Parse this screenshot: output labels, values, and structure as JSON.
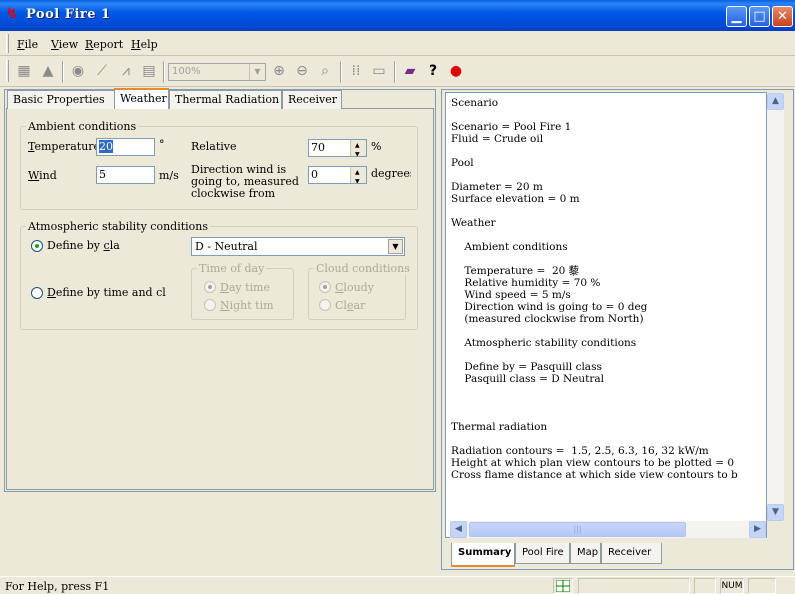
{
  "window": {
    "title": "Pool Fire 1",
    "icon": "app-logo-icon"
  },
  "menu": [
    {
      "key": "F",
      "rest": "ile"
    },
    {
      "key": "V",
      "rest": "iew"
    },
    {
      "key": "R",
      "rest": "eport"
    },
    {
      "key": "H",
      "rest": "elp"
    }
  ],
  "toolbar": {
    "zoom_value": "100%",
    "icons": [
      "table-icon",
      "mountain-icon",
      "person-icon",
      "graph-icon",
      "graph-2-icon",
      "report-icon",
      "zoom-in-icon",
      "zoom-out-icon",
      "zoom-icon",
      "grid-icon",
      "layout-icon",
      "book-icon",
      "help-icon",
      "stop-icon"
    ]
  },
  "left_tabs": [
    "Basic Properties",
    "Weather",
    "Thermal Radiation",
    "Receiver"
  ],
  "ambient": {
    "title": "Ambient conditions",
    "temperature_key": "T",
    "temperature_rest": "emperature",
    "temperature_value": "20",
    "temperature_unit": "°",
    "wind_key": "W",
    "wind_rest": "ind",
    "wind_value": "5",
    "wind_unit": "m/s",
    "relative_label": "Relative",
    "humidity_value": "70",
    "humidity_unit": "%",
    "direction_label": "Direction wind is going to, measured clockwise from",
    "direction_value": "0",
    "direction_unit": "degrees"
  },
  "stability": {
    "title": "Atmospheric stability conditions",
    "define_class_label_a": "Define by ",
    "define_class_key": "c",
    "define_class_label_b": "la",
    "define_time_key": "D",
    "define_time_rest": "efine by time and cl",
    "class_value": "D - Neutral",
    "time_of_day_title": "Time of day",
    "day_time_key": "D",
    "day_time_rest": "ay time",
    "night_time_key": "N",
    "night_time_rest": "ight tim",
    "cloud_title": "Cloud conditions",
    "cloudy_key": "C",
    "cloudy_rest": "loudy",
    "clear_a": "Cl",
    "clear_key": "e",
    "clear_b": "ar"
  },
  "summary_lines": [
    "Scenario",
    "",
    "Scenario = Pool Fire 1",
    "Fluid = Crude oil",
    "",
    "Pool",
    "",
    "Diameter = 20 m",
    "Surface elevation = 0 m",
    "",
    "Weather",
    "",
    "    Ambient conditions",
    "",
    "    Temperature =  20 藜",
    "    Relative humidity = 70 %",
    "    Wind speed = 5 m/s",
    "    Direction wind is going to = 0 deg",
    "    (measured clockwise from North)",
    "",
    "    Atmospheric stability conditions",
    "",
    "    Define by = Pasquill class",
    "    Pasquill class = D Neutral",
    "",
    "",
    "",
    "Thermal radiation",
    "",
    "Radiation contours =  1.5, 2.5, 6.3, 16, 32 kW/m",
    "Height at which plan view contours to be plotted = 0",
    "Cross flame distance at which side view contours to b"
  ],
  "bottom_tabs": [
    "Summary",
    "Pool Fire",
    "Map",
    "Receiver"
  ],
  "status": {
    "help": "For Help, press F1",
    "num": "NUM"
  }
}
